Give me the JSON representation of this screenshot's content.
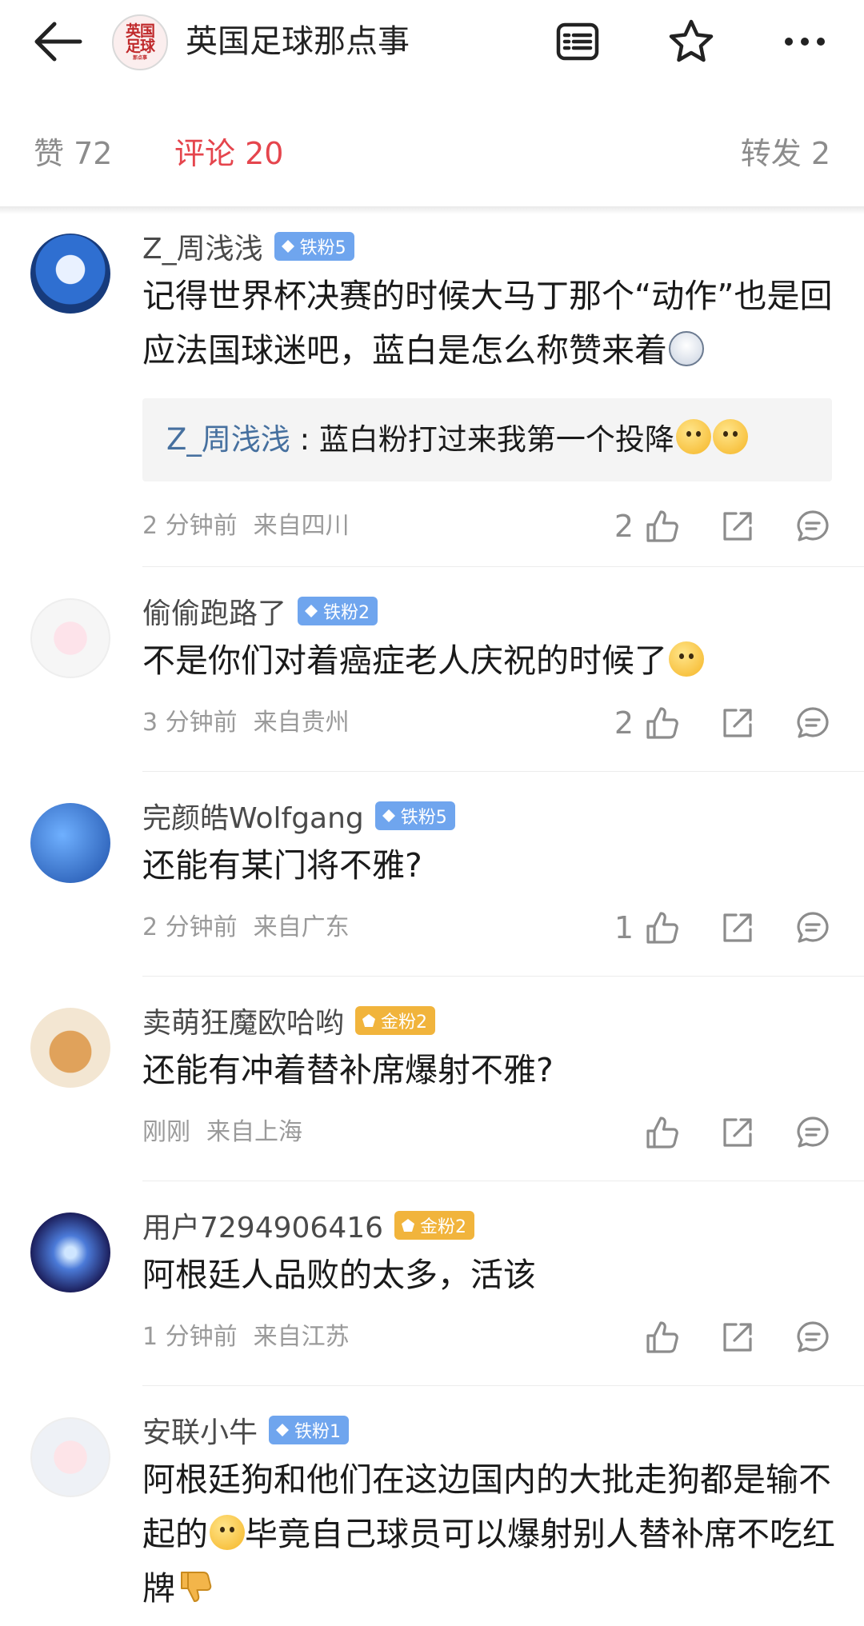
{
  "header": {
    "title": "英国足球那点事",
    "logo_lines": [
      "英国",
      "足球",
      "那点事"
    ],
    "icons": [
      "back-arrow-icon",
      "list-icon",
      "star-icon",
      "more-icon"
    ]
  },
  "tabs": [
    {
      "label": "赞 72"
    },
    {
      "label": "评论 20"
    },
    {
      "label": "转发 2"
    }
  ],
  "comments": [
    {
      "name": "Z_周浅浅",
      "badge": "铁粉5",
      "text": "记得世界杯决赛的时候大马丁那个“动作”也是回应法国球迷吧，蓝白是怎么称赞来着",
      "reply": {
        "name": "Z_周浅浅",
        "sep": " : ",
        "text": "蓝白粉打过来我第一个投降"
      },
      "time": "2 分钟前",
      "location": "来自四川",
      "likes": "2"
    },
    {
      "name": "偷偷跑路了",
      "badge": "铁粉2",
      "text": "不是你们对着癌症老人庆祝的时候了",
      "time": "3 分钟前",
      "location": "来自贵州",
      "likes": "2"
    },
    {
      "name": "完颜皓Wolfgang",
      "badge": "铁粉5",
      "text": "还能有某门将不雅?",
      "time": "2 分钟前",
      "location": "来自广东",
      "likes": "1"
    },
    {
      "name": "卖萌狂魔欧哈哟",
      "badge": "金粉2",
      "text": "还能有冲着替补席爆射不雅?",
      "time": "刚刚",
      "location": "来自上海",
      "likes": ""
    },
    {
      "name": "用户7294906416",
      "badge": "金粉2",
      "text": "阿根廷人品败的太多，活该",
      "time": "1 分钟前",
      "location": "来自江苏",
      "likes": ""
    },
    {
      "name": "安联小牛",
      "badge": "铁粉1",
      "text_parts": [
        "阿根廷狗和他们在这边国内的大批走狗都是输不起的",
        "毕竟自己球员可以爆射别人替补席不吃红牌"
      ]
    }
  ],
  "colors": {
    "accent": "#e5454d",
    "iron_badge": "#6fa5ee",
    "gold_badge": "#f1b43c",
    "reply_name": "#46709f"
  }
}
